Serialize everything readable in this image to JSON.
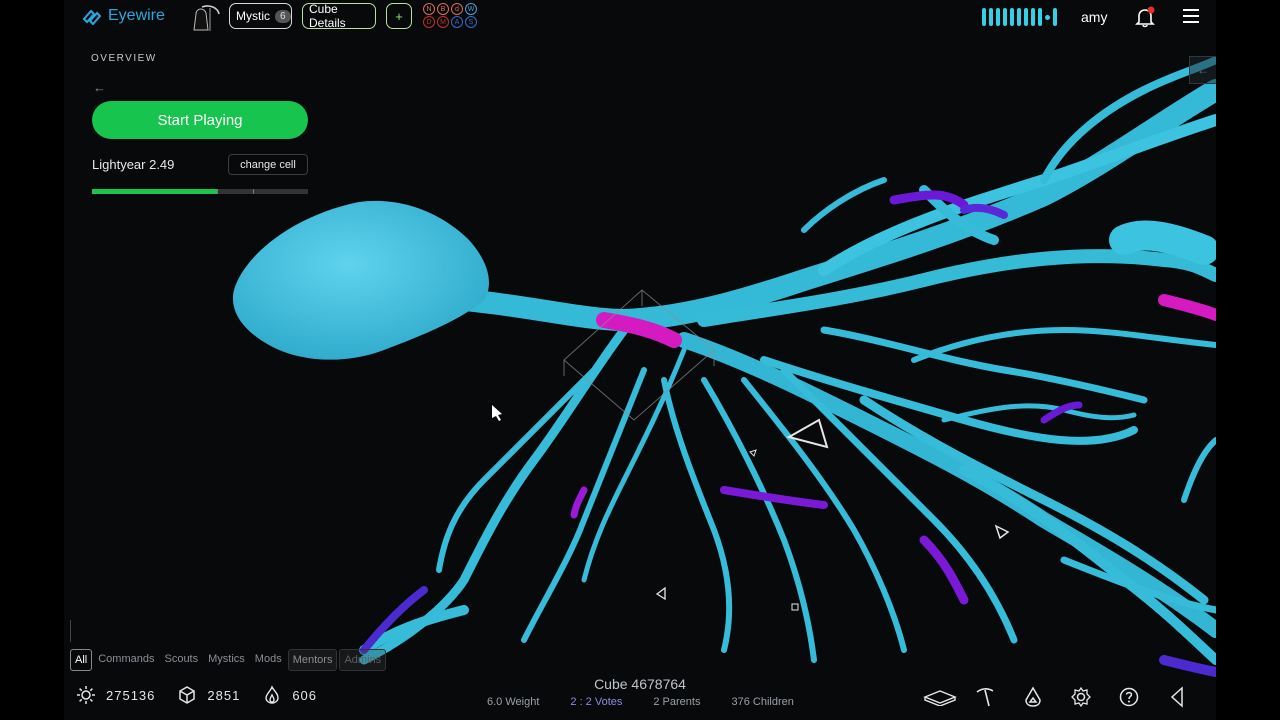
{
  "topbar": {
    "logo_text": "Eyewire",
    "rank_label": "Mystic",
    "rank_count": "6",
    "cube_details_label": "Cube Details",
    "plus_label": "+",
    "mode_letters_top": [
      "N",
      "B",
      "d",
      "W"
    ],
    "mode_letters_bottom": [
      "D",
      "M",
      "A",
      "S"
    ],
    "username": "amy"
  },
  "overview": {
    "label": "OVERVIEW",
    "back_arrow": "←",
    "start_button": "Start Playing",
    "cell_name": "Lightyear 2.49",
    "change_cell_button": "change cell",
    "progress": 0.58
  },
  "chat": {
    "tabs": [
      "All",
      "Commands",
      "Scouts",
      "Mystics",
      "Mods",
      "Mentors",
      "Admins"
    ],
    "active_tab": "All"
  },
  "stats": {
    "points": "275136",
    "cubes": "2851",
    "trailblazes": "606"
  },
  "cube": {
    "title": "Cube 4678764",
    "weight": "6.0 Weight",
    "votes": "2 : 2 Votes",
    "parents": "2 Parents",
    "children": "376 Children"
  },
  "colors": {
    "accent_green": "#17c44e",
    "neuron_cyan": "#36bcd9",
    "segment_magenta": "#d41ac0",
    "segment_violet": "#6a1ad6",
    "logo_blue": "#29a8e0"
  },
  "icons": {
    "stat_points": "sun-icon",
    "stat_cubes": "cube-icon",
    "stat_trailblazes": "flame-icon",
    "tools": [
      "plane-view-icon",
      "pickaxe-icon",
      "drop-icon",
      "settings-icon",
      "help-icon",
      "collapse-icon"
    ]
  }
}
